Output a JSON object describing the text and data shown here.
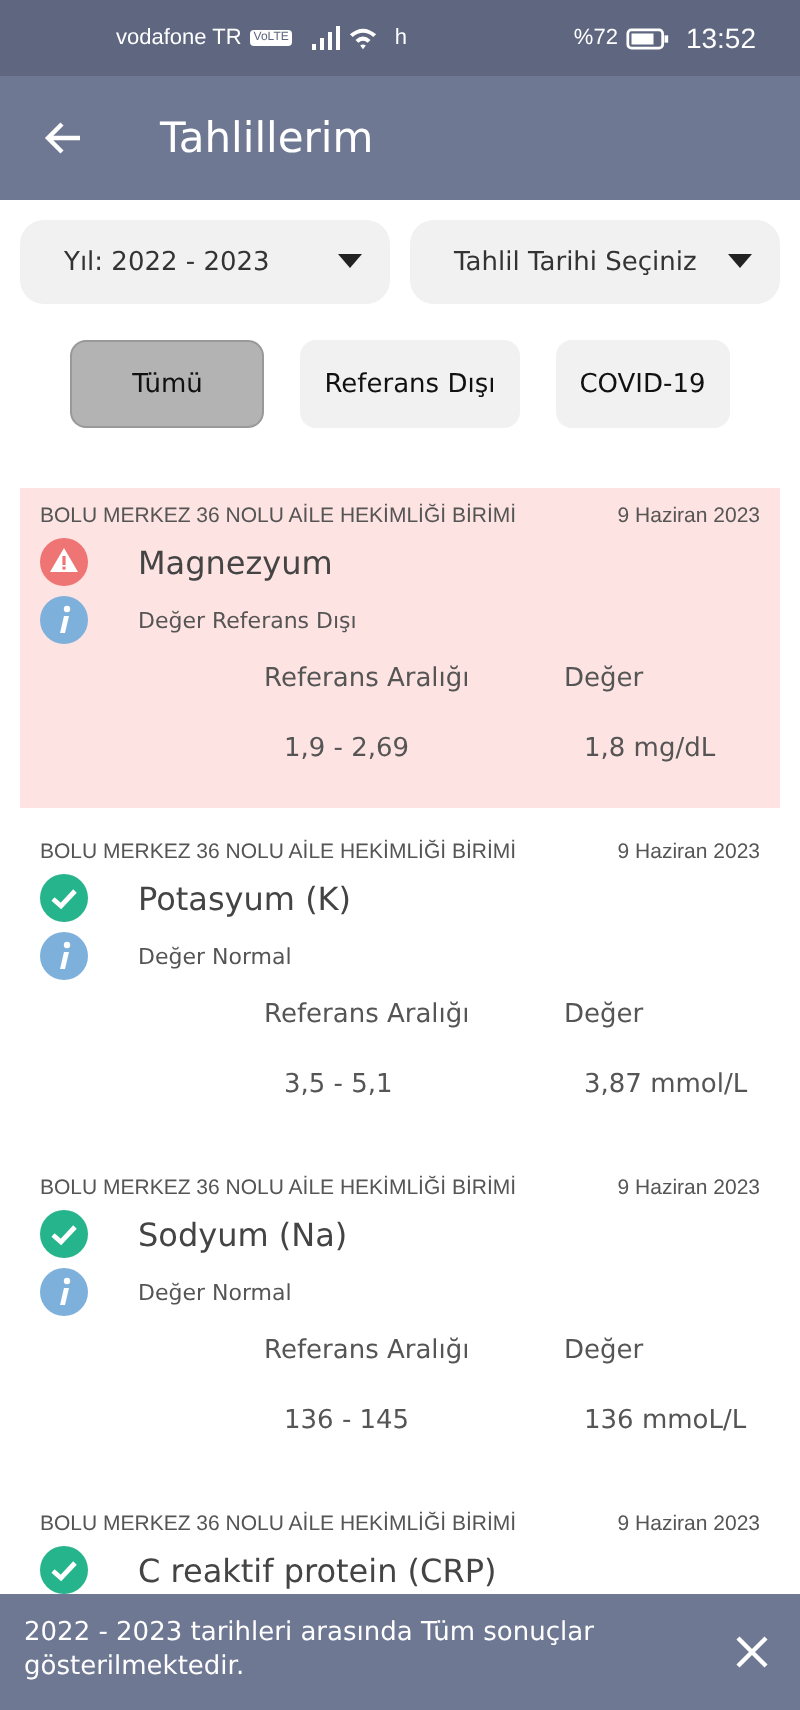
{
  "status_bar": {
    "carrier": "vodafone TR",
    "volte": "VoLTE",
    "network": "h",
    "battery": "%72",
    "time": "13:52"
  },
  "app_bar": {
    "title": "Tahlillerim"
  },
  "filters": [
    {
      "label": "Yıl: 2022 - 2023"
    },
    {
      "label": "Tahlil Tarihi Seçiniz"
    }
  ],
  "chips": [
    {
      "label": "Tümü",
      "selected": true
    },
    {
      "label": "Referans Dışı",
      "selected": false
    },
    {
      "label": "COVID-19",
      "selected": false
    }
  ],
  "results": [
    {
      "facility": "BOLU MERKEZ 36 NOLU AİLE HEKİMLİĞİ BİRİMİ",
      "date": "9 Haziran 2023",
      "name": "Magnezyum",
      "out_of_range": true,
      "status": "Değer Referans Dışı",
      "range_label": "Referans Aralığı",
      "value_label": "Değer",
      "range": "1,9 - 2,69",
      "value": "1,8 mg/dL"
    },
    {
      "facility": "BOLU MERKEZ 36 NOLU AİLE HEKİMLİĞİ BİRİMİ",
      "date": "9 Haziran 2023",
      "name": "Potasyum (K)",
      "out_of_range": false,
      "status": "Değer Normal",
      "range_label": "Referans Aralığı",
      "value_label": "Değer",
      "range": "3,5 - 5,1",
      "value": "3,87 mmol/L"
    },
    {
      "facility": "BOLU MERKEZ 36 NOLU AİLE HEKİMLİĞİ BİRİMİ",
      "date": "9 Haziran 2023",
      "name": "Sodyum (Na)",
      "out_of_range": false,
      "status": "Değer Normal",
      "range_label": "Referans Aralığı",
      "value_label": "Değer",
      "range": "136 - 145",
      "value": "136 mmoL/L"
    },
    {
      "facility": "BOLU MERKEZ 36 NOLU AİLE HEKİMLİĞİ BİRİMİ",
      "date": "9 Haziran 2023",
      "name": "C reaktif protein (CRP)",
      "out_of_range": false
    }
  ],
  "snackbar": {
    "message": "2022 - 2023 tarihleri arasında Tüm sonuçlar gösterilmektedir."
  }
}
